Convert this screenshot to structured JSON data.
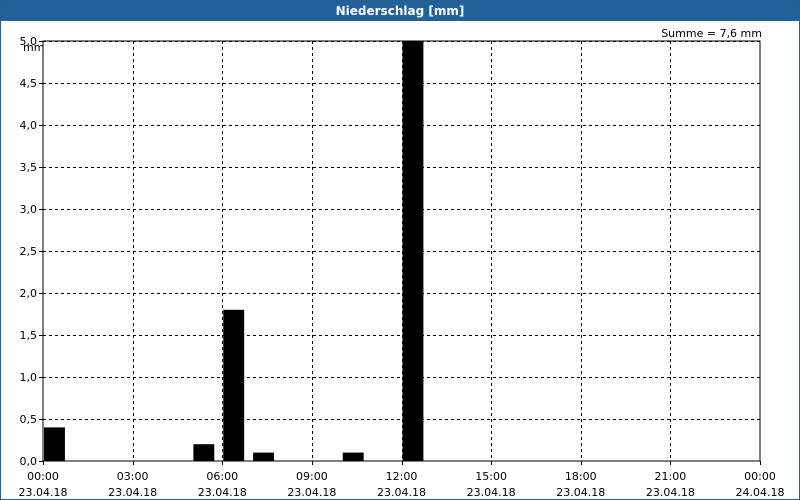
{
  "window": {
    "title": "Niederschlag [mm]"
  },
  "chart_data": {
    "type": "bar",
    "title": "Niederschlag [mm]",
    "ylabel": "mm",
    "xlabel": "",
    "annotation": "Summe = 7,6 mm",
    "ylim": [
      0,
      5.0
    ],
    "yticks": [
      0,
      0.5,
      1.0,
      1.5,
      2.0,
      2.5,
      3.0,
      3.5,
      4.0,
      4.5,
      5.0
    ],
    "ytick_labels": [
      "0,0",
      "0,5",
      "1,0",
      "1,5",
      "2,0",
      "2,5",
      "3,0",
      "3,5",
      "4,0",
      "4,5",
      "5,0"
    ],
    "xlim": [
      "23.04.18 00:00",
      "24.04.18 00:00"
    ],
    "xtick_labels": [
      {
        "time": "00:00",
        "date": "23.04.18"
      },
      {
        "time": "03:00",
        "date": "23.04.18"
      },
      {
        "time": "06:00",
        "date": "23.04.18"
      },
      {
        "time": "09:00",
        "date": "23.04.18"
      },
      {
        "time": "12:00",
        "date": "23.04.18"
      },
      {
        "time": "15:00",
        "date": "23.04.18"
      },
      {
        "time": "18:00",
        "date": "23.04.18"
      },
      {
        "time": "21:00",
        "date": "23.04.18"
      },
      {
        "time": "00:00",
        "date": "24.04.18"
      }
    ],
    "grid": true,
    "bar_color": "#000000",
    "x": [
      "00:00",
      "05:00",
      "06:00",
      "07:00",
      "10:00",
      "12:00"
    ],
    "values": [
      0.4,
      0.2,
      1.8,
      0.1,
      0.1,
      5.0
    ]
  }
}
